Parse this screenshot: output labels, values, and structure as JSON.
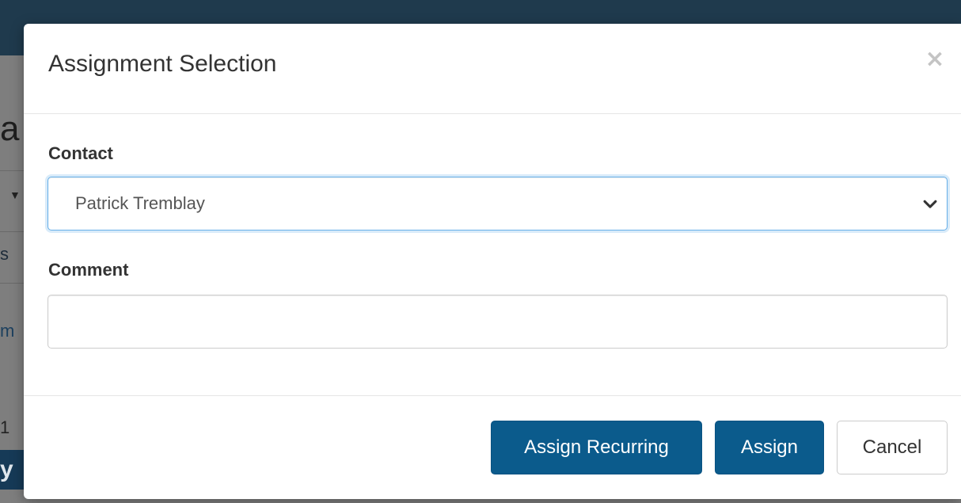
{
  "background": {
    "fragments": {
      "big": "a",
      "s": "s",
      "m": "m",
      "one": "1",
      "y": "y"
    }
  },
  "modal": {
    "title": "Assignment Selection",
    "close_label": "×",
    "contact": {
      "label": "Contact",
      "selected": "Patrick Tremblay"
    },
    "comment": {
      "label": "Comment",
      "value": ""
    },
    "buttons": {
      "assign_recurring": "Assign Recurring",
      "assign": "Assign",
      "cancel": "Cancel"
    }
  },
  "colors": {
    "primary": "#0b5b8c",
    "focus_border": "#66afe9"
  },
  "icons": {
    "close": "close-icon",
    "select_arrow": "chevron-down-icon"
  }
}
